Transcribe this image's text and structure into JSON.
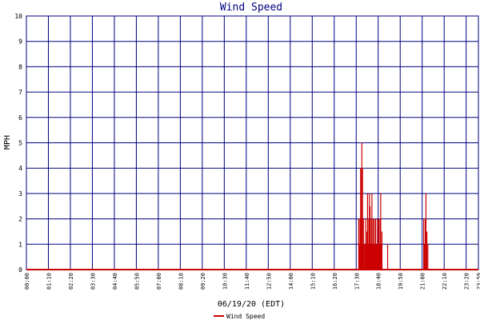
{
  "chart_data": {
    "type": "bar",
    "title": "Wind Speed",
    "xlabel": "06/19/20 (EDT)",
    "ylabel": "MPH",
    "ylim": [
      0,
      10
    ],
    "y_ticks": [
      "0",
      "1",
      "2",
      "3",
      "4",
      "5",
      "6",
      "7",
      "8",
      "9",
      "10"
    ],
    "x_ticks": [
      "00:00",
      "01:10",
      "02:20",
      "03:30",
      "04:40",
      "05:50",
      "07:00",
      "08:10",
      "09:20",
      "10:30",
      "11:40",
      "12:50",
      "14:00",
      "15:10",
      "16:20",
      "17:30",
      "18:40",
      "19:50",
      "21:00",
      "22:10",
      "23:20",
      "23:59"
    ],
    "x_tick_minutes": [
      0,
      70,
      140,
      210,
      280,
      350,
      420,
      490,
      560,
      630,
      700,
      770,
      840,
      910,
      980,
      1050,
      1120,
      1190,
      1260,
      1330,
      1400,
      1439
    ],
    "xlim_minutes": [
      0,
      1439
    ],
    "grid": true,
    "legend_position": "bottom-center",
    "colors": {
      "series": "#cc0000",
      "grid": "#000080",
      "title": "#000080",
      "text": "#000000"
    },
    "series": [
      {
        "name": "Wind Speed",
        "x_minutes": [
          1058,
          1060,
          1062,
          1063,
          1064,
          1065,
          1066,
          1067,
          1068,
          1069,
          1070,
          1071,
          1073,
          1075,
          1078,
          1080,
          1082,
          1084,
          1086,
          1088,
          1090,
          1092,
          1094,
          1096,
          1098,
          1100,
          1102,
          1104,
          1106,
          1108,
          1110,
          1112,
          1114,
          1116,
          1118,
          1120,
          1122,
          1124,
          1126,
          1128,
          1130,
          1132,
          1150,
          1265,
          1267,
          1270,
          1272,
          1275,
          1278
        ],
        "values": [
          2,
          1,
          2,
          1,
          4,
          1,
          2,
          4,
          5,
          1,
          4,
          1,
          2,
          1,
          1,
          2,
          1,
          1.5,
          3,
          1,
          2,
          3,
          2.5,
          1,
          2,
          3,
          1,
          2,
          1,
          2,
          1,
          2,
          1,
          1,
          2,
          1,
          2,
          1,
          2,
          3,
          1,
          1.5,
          1,
          2,
          1,
          2,
          3,
          1.5,
          1
        ]
      }
    ]
  }
}
